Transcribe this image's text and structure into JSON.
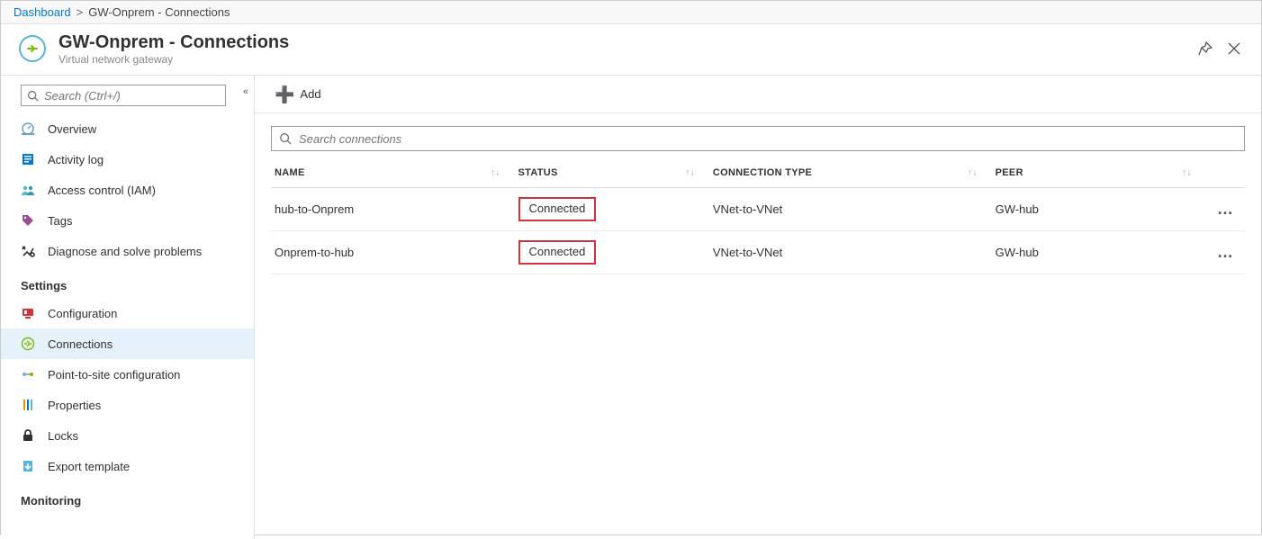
{
  "breadcrumb": {
    "root": "Dashboard",
    "current": "GW-Onprem - Connections"
  },
  "header": {
    "title": "GW-Onprem - Connections",
    "subtitle": "Virtual network gateway"
  },
  "sidebar": {
    "search_placeholder": "Search (Ctrl+/)",
    "items_top": [
      {
        "label": "Overview",
        "icon": "overview"
      },
      {
        "label": "Activity log",
        "icon": "activitylog"
      },
      {
        "label": "Access control (IAM)",
        "icon": "iam"
      },
      {
        "label": "Tags",
        "icon": "tags"
      },
      {
        "label": "Diagnose and solve problems",
        "icon": "diagnose"
      }
    ],
    "group_settings": "Settings",
    "items_settings": [
      {
        "label": "Configuration",
        "icon": "configuration"
      },
      {
        "label": "Connections",
        "icon": "connections",
        "selected": true
      },
      {
        "label": "Point-to-site configuration",
        "icon": "p2s"
      },
      {
        "label": "Properties",
        "icon": "properties"
      },
      {
        "label": "Locks",
        "icon": "locks"
      },
      {
        "label": "Export template",
        "icon": "export"
      }
    ],
    "group_monitoring": "Monitoring"
  },
  "toolbar": {
    "add_label": "Add"
  },
  "grid": {
    "filter_placeholder": "Search connections",
    "columns": {
      "name": "NAME",
      "status": "STATUS",
      "type": "CONNECTION TYPE",
      "peer": "PEER"
    },
    "rows": [
      {
        "name": "hub-to-Onprem",
        "status": "Connected",
        "type": "VNet-to-VNet",
        "peer": "GW-hub"
      },
      {
        "name": "Onprem-to-hub",
        "status": "Connected",
        "type": "VNet-to-VNet",
        "peer": "GW-hub"
      }
    ]
  }
}
